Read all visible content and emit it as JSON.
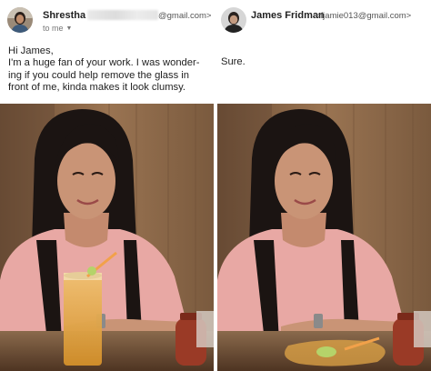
{
  "left_email": {
    "sender_name": "Shrestha",
    "sender_email": "@gmail.com>",
    "recipient_label": "to me",
    "avatar_icon": "user-avatar-icon",
    "message_lines": [
      "Hi James,",
      "I'm a huge fan of your work. I was wonder-",
      "ing if you could help remove the glass in",
      "front of me, kinda makes it look clumsy."
    ],
    "photo": "original-photo-with-glass"
  },
  "right_email": {
    "sender_name": "James Fridman",
    "sender_email": "<fjamie013@gmail.com>",
    "avatar_icon": "user-avatar-icon",
    "message_lines": [
      "Sure."
    ],
    "photo": "edited-photo-glass-spilled"
  },
  "colors": {
    "shirt": "#e8a8a4",
    "hair": "#1b1412",
    "wood_wall": "#8c6a4a",
    "table": "#6b4a30",
    "drink": "#e2a547"
  }
}
